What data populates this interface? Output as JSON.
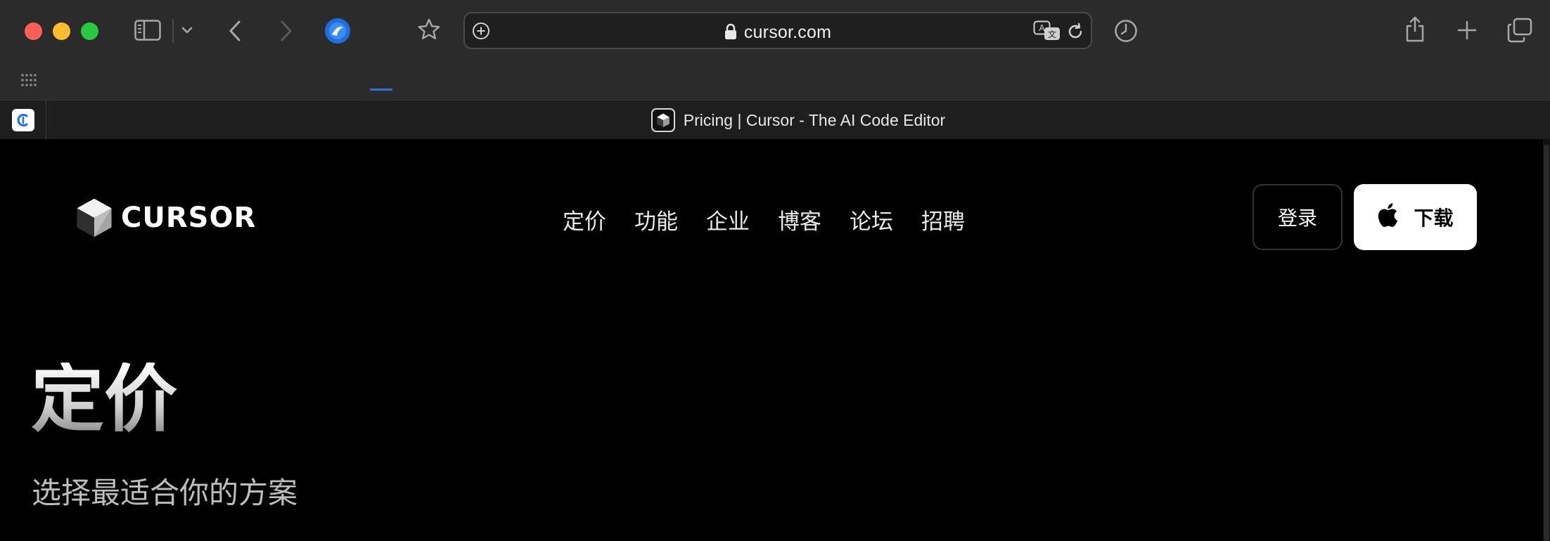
{
  "browser": {
    "url": "cursor.com",
    "tab_title": "Pricing | Cursor - The AI Code Editor",
    "icons": {
      "sidebar": "sidebar-icon",
      "chevron": "chevron-down-icon",
      "back": "back-arrow-icon",
      "forward": "forward-arrow-icon",
      "extension": "extension-icon",
      "bookmark": "star-icon",
      "site_info": "plus-circle-icon",
      "lock": "lock-icon",
      "translate": "translate-icon",
      "reload": "reload-icon",
      "history": "clock-icon",
      "share": "share-icon",
      "new_tab": "plus-icon",
      "tabs_overview": "tabs-overview-icon",
      "apps_grid": "grid-icon"
    },
    "traffic_colors": {
      "close": "#ff5f57",
      "minimize": "#febc2e",
      "zoom": "#28c840"
    }
  },
  "site": {
    "brand": "CURSOR",
    "nav": [
      "定价",
      "功能",
      "企业",
      "博客",
      "论坛",
      "招聘"
    ],
    "login_label": "登录",
    "download_label": "下载",
    "download_icon": "apple-icon"
  },
  "hero": {
    "title": "定价",
    "subtitle": "选择最适合你的方案"
  }
}
